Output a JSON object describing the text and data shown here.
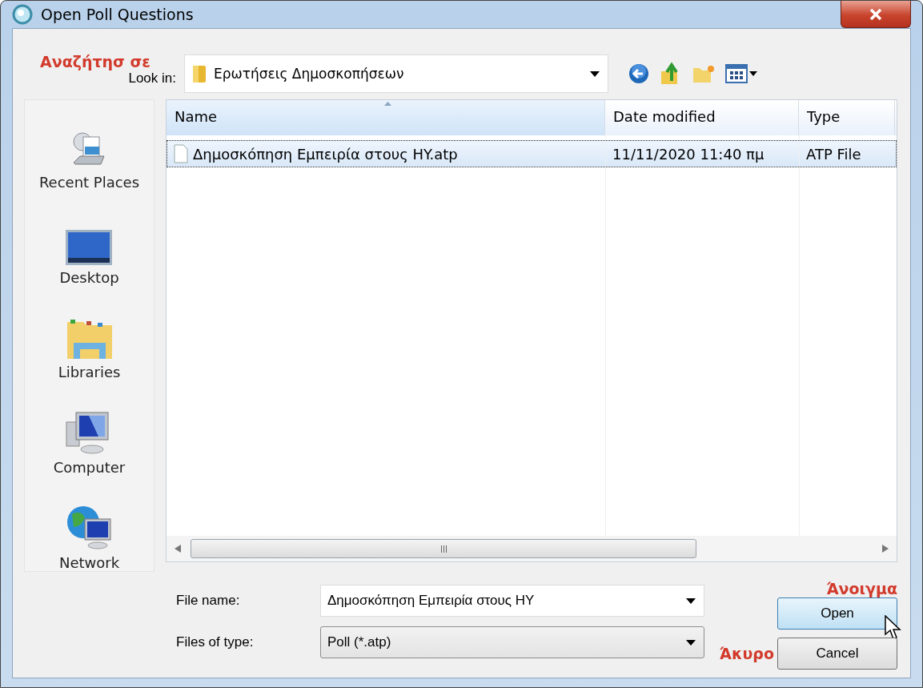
{
  "window": {
    "title": "Open Poll Questions"
  },
  "look_in": {
    "label": "Look in:",
    "value": "Ερωτήσεις Δημοσκοπήσεων",
    "annotation": "Αναζήτησ σε"
  },
  "sidebar": {
    "items": [
      {
        "label": "Recent Places",
        "kind": "recent"
      },
      {
        "label": "Desktop",
        "kind": "desktop"
      },
      {
        "label": "Libraries",
        "kind": "libraries"
      },
      {
        "label": "Computer",
        "kind": "computer"
      },
      {
        "label": "Network",
        "kind": "network"
      }
    ]
  },
  "table": {
    "columns": [
      {
        "label": "Name",
        "sorted": true
      },
      {
        "label": "Date modified",
        "sorted": false
      },
      {
        "label": "Type",
        "sorted": false
      }
    ],
    "rows": [
      {
        "cells": [
          "Δημοσκόπηση Εμπειρία στους HY.atp",
          "11/11/2020 11:40 πμ",
          "ATP File"
        ],
        "selected": true
      }
    ]
  },
  "file_name": {
    "label": "File name:",
    "value": "Δημοσκόπηση Εμπειρία στους HY"
  },
  "file_type": {
    "label": "Files of type:",
    "value": "Poll (*.atp)"
  },
  "buttons": [
    {
      "label": "Open",
      "kind": "default",
      "annotation": "Άνοιγμα"
    },
    {
      "label": "Cancel",
      "kind": "normal",
      "annotation": "Άκυρο"
    }
  ]
}
